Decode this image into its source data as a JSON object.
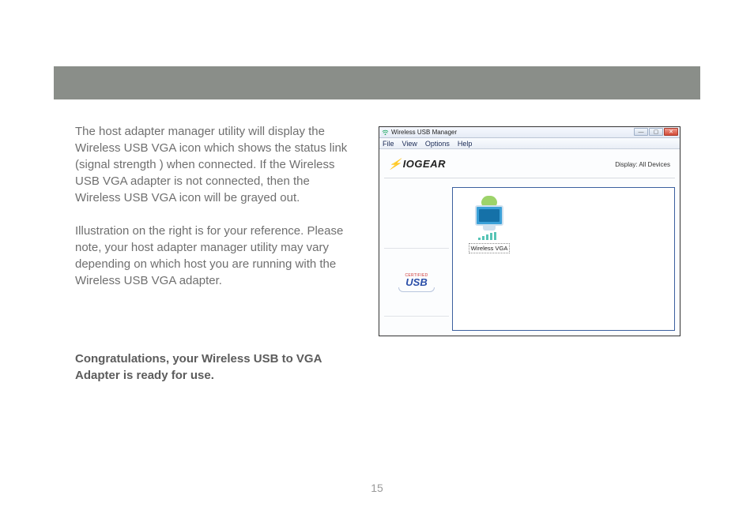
{
  "doc": {
    "para1": "The host adapter manager utility will display the Wireless USB VGA icon which shows the status link (signal strength ) when connected. If the Wireless USB VGA adapter is not connected, then the Wireless USB VGA icon will be grayed out.",
    "para2": "Illustration on the right is for your reference. Please note, your host adapter manager utility may vary depending on which host you are running with the Wireless USB VGA adapter.",
    "congrats": "Congratulations, your Wireless USB to VGA Adapter is ready for use.",
    "page_number": "15"
  },
  "app": {
    "title": "Wireless USB Manager",
    "menu": {
      "file": "File",
      "view": "View",
      "options": "Options",
      "help": "Help"
    },
    "brand": "IOGEAR",
    "display_label": "Display: All Devices",
    "sidebar_badge": {
      "line1": "CERTIFIED",
      "line2": "USB"
    },
    "device": {
      "label": "Wireless VGA"
    },
    "win_controls": {
      "minimize": "—",
      "maximize": "▢",
      "close": "✕"
    }
  }
}
